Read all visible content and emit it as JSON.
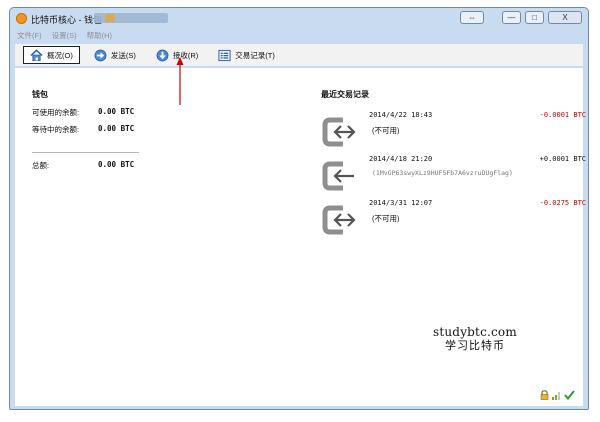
{
  "window": {
    "title": "比特币核心 - 钱包",
    "controls": {
      "restore": "⇔",
      "minimize": "—",
      "maximize": "□",
      "close": "X"
    }
  },
  "menu": [
    "文件(F)",
    "设置(S)",
    "帮助(H)"
  ],
  "toolbar": {
    "overview": "概况(O)",
    "send": "发送(S)",
    "receive": "接收(R)",
    "transactions": "交易记录(T)"
  },
  "wallet": {
    "title": "钱包",
    "available_label": "可使用的余额:",
    "available_value": "0.00 BTC",
    "pending_label": "等待中的余额:",
    "pending_value": "0.00 BTC",
    "total_label": "总额:",
    "total_value": "0.00 BTC"
  },
  "recent": {
    "title": "最近交易记录",
    "items": [
      {
        "date": "2014/4/22 18:43",
        "sub": "(不可用)",
        "amount": "-0.0001 BTC",
        "direction": "sent",
        "color": "#cc0000"
      },
      {
        "date": "2014/4/18 21:20",
        "sub": "(1MvGP63swyXLz9HUF5Fb7A6vzruDUgFlag)",
        "amount": "+0.0001 BTC",
        "direction": "received",
        "color": "#111111"
      },
      {
        "date": "2014/3/31 12:07",
        "sub": "(不可用)",
        "amount": "-0.0275 BTC",
        "direction": "sent",
        "color": "#cc0000"
      }
    ]
  },
  "watermark": {
    "line1": "studybtc.com",
    "line2": "学习比特币"
  },
  "icons": {
    "overview": "home-icon",
    "send": "send-arrow-icon",
    "receive": "receive-arrow-icon",
    "transactions": "list-icon",
    "status": [
      "lock-icon",
      "signal-icon",
      "checkmark-icon"
    ]
  },
  "colors": {
    "negative": "#cc0000",
    "annotation_arrow": "#cc0000",
    "accent": "#2f6fc4"
  }
}
